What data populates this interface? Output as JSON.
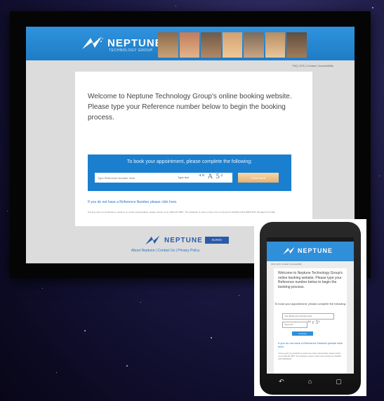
{
  "site": {
    "logo_text": "NEPTUNE",
    "logo_subtitle": "TECHNOLOGY GROUP",
    "utility_nav": "FAQ  |  ES  |  Contact  |  Accessibility",
    "welcome_text": "Welcome to Neptune Technology Group's online booking website. Please type your Reference number below to begin the booking process.",
    "book_title": "To book your appointment, please complete the following:",
    "reference_placeholder": "Type Reference Number Here",
    "captcha_label": "Type text",
    "captcha_code": "⁴⁸ A 5²",
    "continue_label": "CONTINUE",
    "no_reference_link": "If you do not have a Reference Number please click here.",
    "fine_print": "If at any point you would like to speak to an onsite representative, please contact us at 1-800-447-3857. The scheduler is open to help in the morning from 8:00AM until 5:30PM EST, Monday thru Friday.",
    "footer_logo_text": "NEPTUNE",
    "footer_badge": "ROPER",
    "footer_links": "About Neptune  |  Contact Us  |  Privacy Policy"
  },
  "phone": {
    "logo_text": "NEPTUNE",
    "nav": "FAQ | ES | Contact | Accessibility",
    "welcome_text": "Welcome to Neptune Technology Group's online booking website. Please type your Reference number below to begin the booking process.",
    "book_title": "To book your appointment, please complete the following:",
    "reference_placeholder": "Your Reference Number Here",
    "captcha_label": "Type text",
    "captcha_code": "³⁴ r 5²",
    "continue_label": "Continue",
    "no_reference_link": "If you do not have a Reference Number please click here.",
    "fine_print": "If at any point you would like to speak to an onsite representative, please contact us at 1-800-447-3857. The scheduler is open to help in the morning from 8:00AM until 5:30PM EST."
  },
  "colors": {
    "brand_blue": "#1f7cc6",
    "button_orange": "#e5b072",
    "link_blue": "#2a72c4"
  }
}
